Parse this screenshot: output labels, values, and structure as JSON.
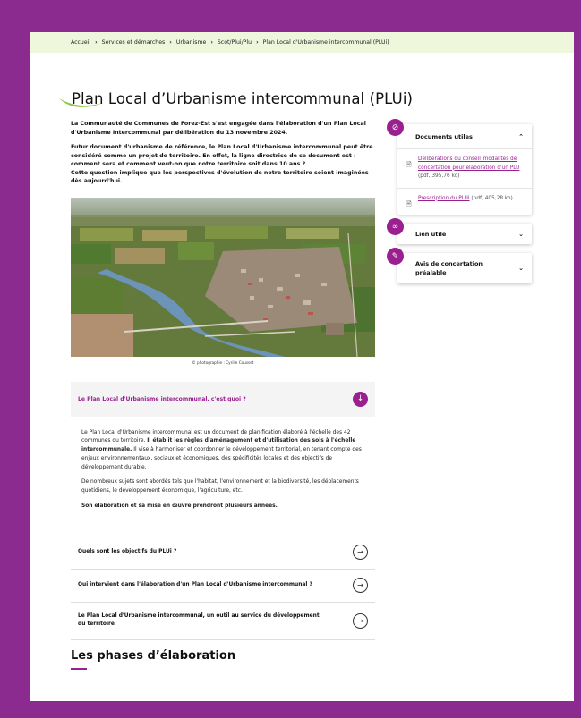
{
  "breadcrumb": [
    "Accueil",
    "Services et démarches",
    "Urbanisme",
    "Scot/Plui/Plu",
    "Plan Local d'Urbanisme intercommunal (PLUi)"
  ],
  "page_title": "Plan Local d’Urbanisme intercommunal (PLUi)",
  "intro": {
    "p1": "La Communauté de Communes de Forez-Est s'est engagée dans l'élaboration d'un Plan Local d'Urbanisme Intercommunal par délibération du 13 novembre 2024.",
    "p2": "Futur document d'urbanisme de référence, le Plan Local d'Urbanisme intercommunal peut être considéré comme un projet de territoire. En effet, la ligne directrice de ce document est : comment sera et comment veut-on que notre territoire soit dans 10 ans ?",
    "p3": "Cette question implique que les perspectives d'évolution de notre territoire soient imaginées dès aujourd'hui."
  },
  "photo_caption": "© photographie : Cyrille Cousset",
  "accordion_open": {
    "question": "Le Plan Local d'Urbanisme intercommunal, c'est quoi ?",
    "body_p1_a": "Le Plan Local d'Urbanisme intercommunal est un document de planification élaboré à l'échelle des 42 communes du territoire. ",
    "body_p1_b": "Il établit les règles d'aménagement et d'utilisation des sols à l'échelle intercommunale.",
    "body_p1_c": " Il vise à harmoniser et coordonner le développement territorial, en tenant compte des enjeux environnementaux, sociaux et économiques, des spécificités locales et des objectifs de développement durable.",
    "body_p2": "De nombreux sujets sont abordés tels que l'habitat, l'environnement et la biodiversité, les déplacements quotidiens, le développement économique, l'agriculture, etc.",
    "body_p3": "Son élaboration et sa mise en œuvre prendront plusieurs années."
  },
  "accordion_items": [
    "Quels sont les objectifs du PLUi ?",
    "Qui intervient dans l'élaboration d'un Plan Local d'Urbanisme intercommunal ?",
    "Le Plan Local d'Urbanisme intercommunal, un outil au service du développement du territoire"
  ],
  "phases_heading": "Les phases d’élaboration",
  "sidebar": {
    "documents_title": "Documents utiles",
    "documents": [
      {
        "link": "Délibérations du conseil_modalités de concertation pour élaboration d'un PLU",
        "meta": " (pdf, 395,76 ko)"
      },
      {
        "link": "Prescription du PLUi",
        "meta": " (pdf, 405,28 ko)"
      }
    ],
    "lien_title": "Lien utile",
    "avis_title": "Avis de concertation préalable"
  },
  "icons": {
    "breadcrumb_separator": "chevron-right-icon",
    "accordion_open": "arrow-down-circle-icon",
    "accordion_closed": "arrow-right-circle-icon",
    "documents_badge": "paperclip-icon",
    "lien_badge": "link-icon",
    "avis_badge": "pencil-icon",
    "file": "file-icon"
  },
  "colors": {
    "accent": "#9a1f8f",
    "frame": "#8b2a8f",
    "breadcrumb_bg": "#eef6dc",
    "swoosh": "#8cc63f"
  }
}
